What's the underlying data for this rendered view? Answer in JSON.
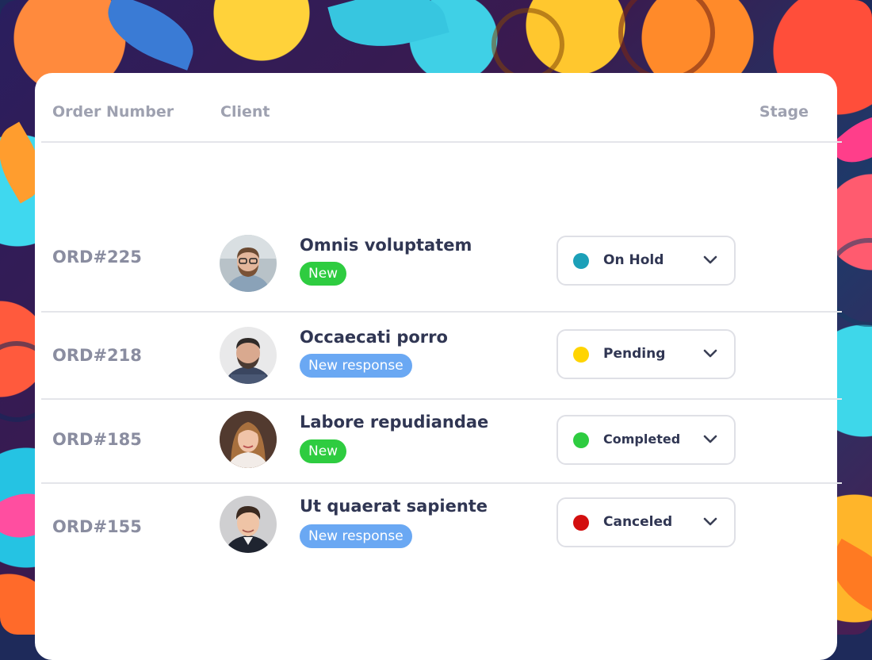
{
  "table": {
    "headers": {
      "order_number": "Order Number",
      "client": "Client",
      "stage": "Stage"
    },
    "rows": [
      {
        "order": "ORD#225",
        "client": "Omnis voluptatem",
        "badge": "New",
        "badge_color": "#2ecc40",
        "stage": "On Hold",
        "stage_color": "#1ca0b8"
      },
      {
        "order": "ORD#218",
        "client": "Occaecati porro",
        "badge": "New response",
        "badge_color": "#6aa8f3",
        "stage": "Pending",
        "stage_color": "#ffd400"
      },
      {
        "order": "ORD#185",
        "client": "Labore repudiandae",
        "badge": "New",
        "badge_color": "#2ecc40",
        "stage": "Completed",
        "stage_color": "#2ecc40"
      },
      {
        "order": "ORD#155",
        "client": "Ut quaerat sapiente",
        "badge": "New response",
        "badge_color": "#6aa8f3",
        "stage": "Canceled",
        "stage_color": "#d30f0f"
      }
    ]
  },
  "icons": {
    "stage_dropdown": "chevron-down-icon"
  }
}
